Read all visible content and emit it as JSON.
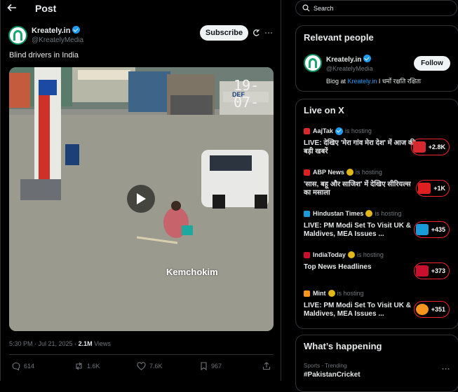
{
  "header": {
    "title": "Post"
  },
  "post": {
    "author_name": "Kreately.in",
    "author_handle": "@KreatelyMedia",
    "subscribe_label": "Subscribe",
    "text": "Blind drivers in India",
    "video": {
      "timestamp_overlay": "19-07-",
      "banner_text": "DEF",
      "watermark": "Kemchokim"
    },
    "time": "5:30 PM · Jul 21, 2025 · ",
    "views_count": "2.1M",
    "views_label": " Views",
    "actions": {
      "replies": "614",
      "reposts": "1.6K",
      "likes": "7.6K",
      "bookmarks": "967"
    }
  },
  "search": {
    "placeholder": "Search"
  },
  "relevant_people": {
    "title": "Relevant people",
    "name": "Kreately.in",
    "handle": "@KreatelyMedia",
    "follow_label": "Follow",
    "bio_prefix": "Blog at ",
    "bio_link": "Kreately.in",
    "bio_suffix": " I धर्मो रक्षति रक्षितः"
  },
  "live_on_x": {
    "title": "Live on X",
    "is_hosting": "is hosting",
    "items": [
      {
        "host": "AajTak",
        "title": "LIVE: देखिए 'मेरा गांव मेरा देश' में आज की बड़ी खबरें",
        "count": "+2.8K",
        "color": "#d7282f"
      },
      {
        "host": "ABP News",
        "title": "'सास, बहू और साजिश' में देखिए सीरियल्स का मसाला",
        "count": "+1K",
        "color": "#e02020"
      },
      {
        "host": "Hindustan Times",
        "title": "LIVE: PM Modi Set To Visit UK & Maldives, MEA Issues ...",
        "count": "+435",
        "color": "#1a9bd7"
      },
      {
        "host": "IndiaToday",
        "title": "Top News Headlines",
        "count": "+373",
        "color": "#c8102e"
      },
      {
        "host": "Mint",
        "title": "LIVE: PM Modi Set To Visit UK & Maldives, MEA Issues ...",
        "count": "+351",
        "color": "#f7941d"
      }
    ]
  },
  "whats_happening": {
    "title": "What’s happening",
    "trend_category": "Sports · Trending",
    "trend_name": "#PakistanCricket"
  }
}
